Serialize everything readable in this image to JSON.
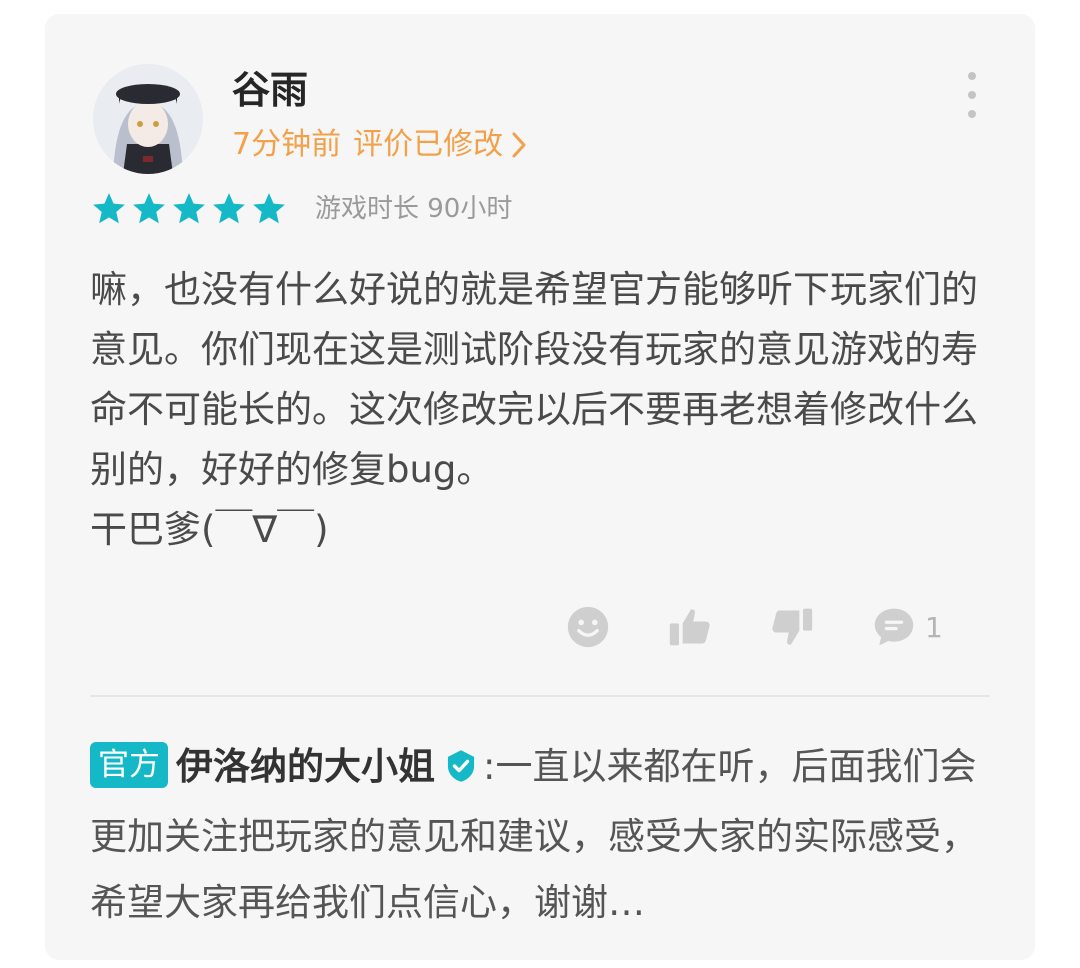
{
  "review": {
    "username": "谷雨",
    "time_ago": "7分钟前",
    "edited_label": "评价已修改",
    "rating": 5,
    "rating_max": 5,
    "playtime": "游戏时长 90小时",
    "content": [
      "嘛，也没有什么好说的就是希望官方能够听下玩家们的意见。你们现在这是测试阶段没有玩家的意见游戏的寿命不可能长的。这次修改完以后不要再老想着修改什么别的，好好的修复bug。",
      "干巴爹(￣∇￣)"
    ],
    "comment_count": "1"
  },
  "reply": {
    "badge": "官方",
    "author": "伊洛纳的大小姐",
    "colon": ":",
    "text": "一直以来都在听，后面我们会更加关注把玩家的意见和建议，感受大家的实际感受，希望大家再给我们点信心，谢谢…"
  },
  "colors": {
    "accent_teal": "#15b8c6",
    "meta_orange": "#f2a14a",
    "icon_grey": "#c4c4c4"
  },
  "icons": {
    "more": "more-vertical-icon",
    "star": "star-icon",
    "emoji": "smiley-icon",
    "like": "thumbs-up-icon",
    "dislike": "thumbs-down-icon",
    "comment": "comment-bubble-icon",
    "verified": "verified-badge-icon",
    "chevron": "chevron-right-icon"
  }
}
